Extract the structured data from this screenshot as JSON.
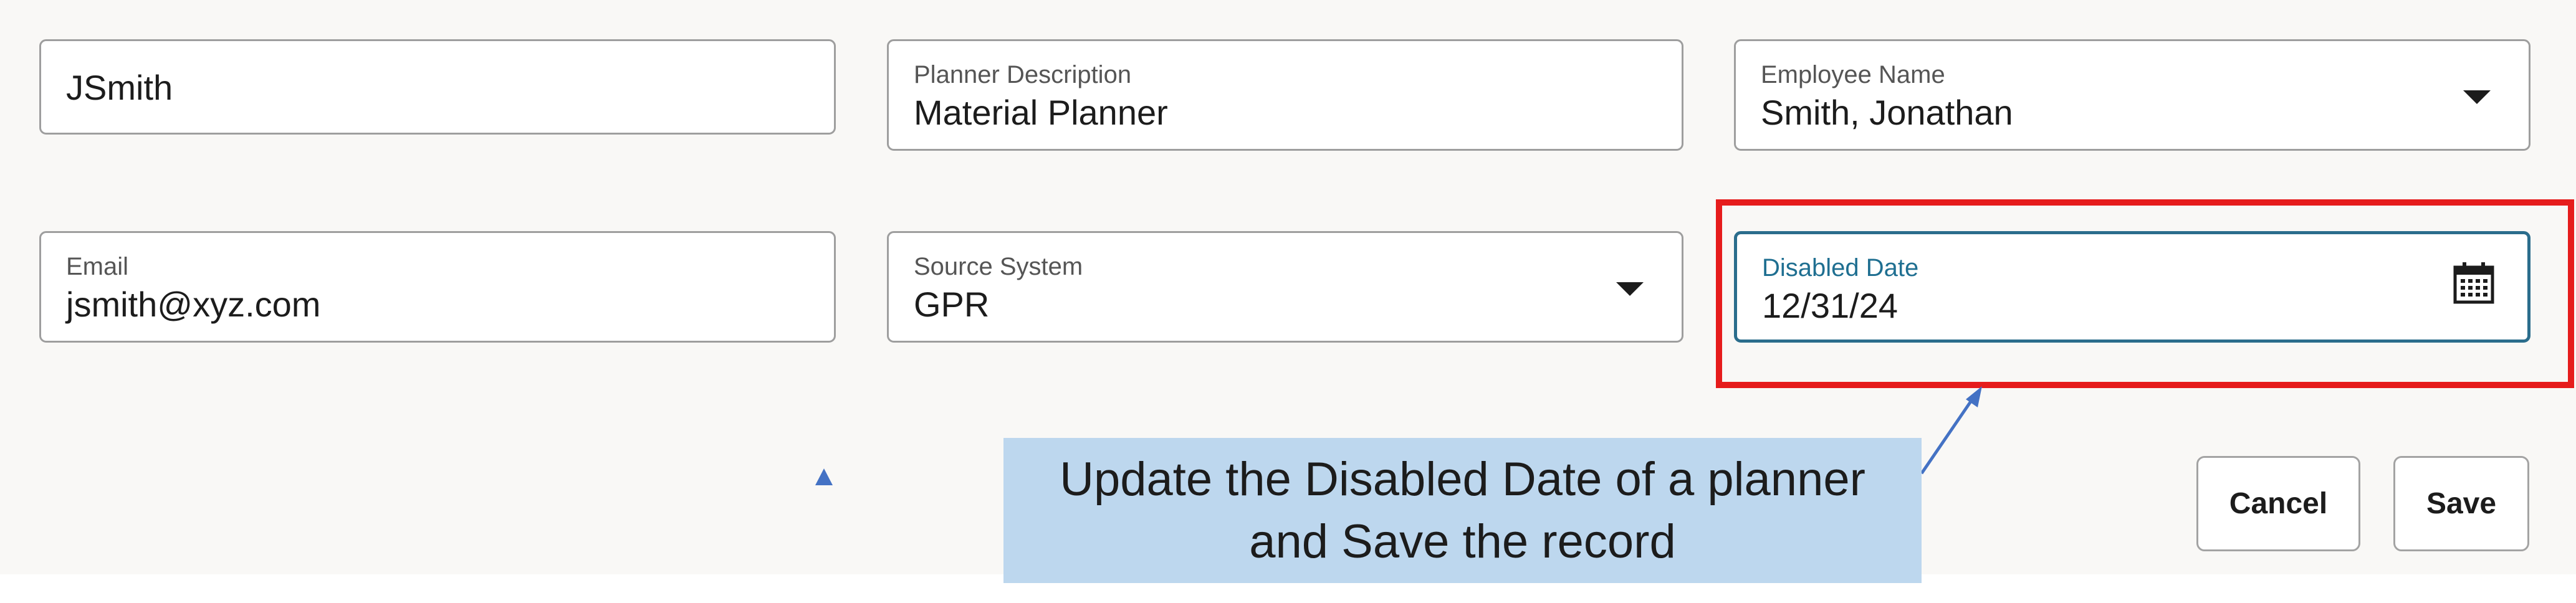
{
  "form": {
    "planner_code": {
      "value": "JSmith"
    },
    "planner_description": {
      "label": "Planner Description",
      "value": "Material Planner"
    },
    "employee_name": {
      "label": "Employee Name",
      "value": "Smith, Jonathan"
    },
    "email": {
      "label": "Email",
      "value": "jsmith@xyz.com"
    },
    "source_system": {
      "label": "Source System",
      "value": "GPR"
    },
    "disabled_date": {
      "label": "Disabled Date",
      "value": "12/31/24"
    }
  },
  "actions": {
    "cancel_label": "Cancel",
    "save_label": "Save"
  },
  "callout": {
    "line1": "Update the Disabled Date of a planner",
    "line2": "and Save the record"
  },
  "icons": {
    "dropdown": "chevron-down-icon",
    "calendar": "calendar-icon"
  },
  "colors": {
    "highlight": "#e61c1c",
    "callout_bg": "#bdd7ee",
    "focus_border": "#2b6d8c",
    "focus_label": "#1f6f91",
    "arrow": "#4472c4"
  }
}
